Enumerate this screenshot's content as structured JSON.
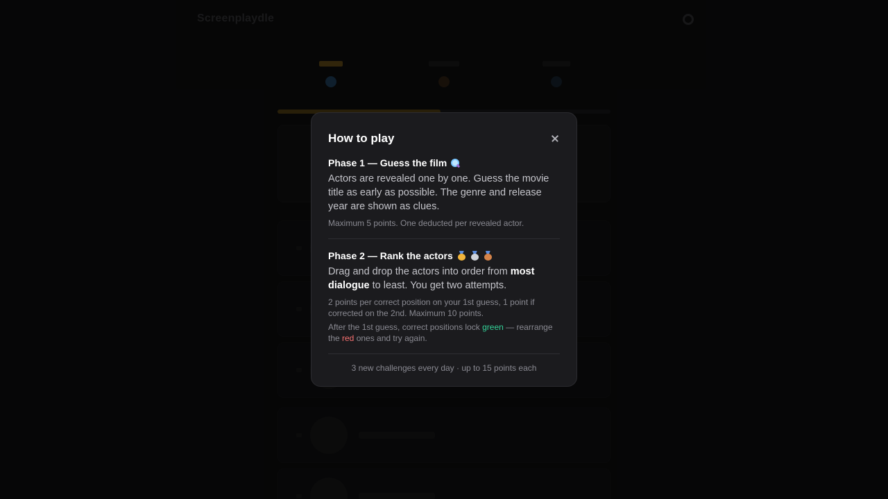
{
  "background": {
    "logo": "Screenplaydle",
    "accent_color": "#f2b53c"
  },
  "modal": {
    "title": "How to play",
    "close_icon": "close-icon",
    "phase1": {
      "heading": "Phase 1 — Guess the film",
      "icon": "magnifier-icon",
      "description": "Actors are revealed one by one. Guess the movie title as early as possible. The genre and release year are shown as clues.",
      "note": "Maximum 5 points. One deducted per revealed actor."
    },
    "phase2": {
      "heading": "Phase 2 — Rank the actors",
      "icons": [
        "gold-medal-icon",
        "silver-medal-icon",
        "bronze-medal-icon"
      ],
      "desc_part1": "Drag and drop the actors into order from ",
      "desc_bold": "most dialogue",
      "desc_part2": " to least. You get two attempts.",
      "note1": "2 points per correct position on your 1st guess, 1 point if corrected on the 2nd. Maximum 10 points.",
      "note2_part1": "After the 1st guess, correct positions lock ",
      "note2_green": "green",
      "note2_part2": " — rearrange the ",
      "note2_red": "red",
      "note2_part3": " ones and try again.",
      "green_color": "#34d399",
      "red_color": "#f87171"
    },
    "footer": "3 new challenges every day · up to 15 points each"
  }
}
